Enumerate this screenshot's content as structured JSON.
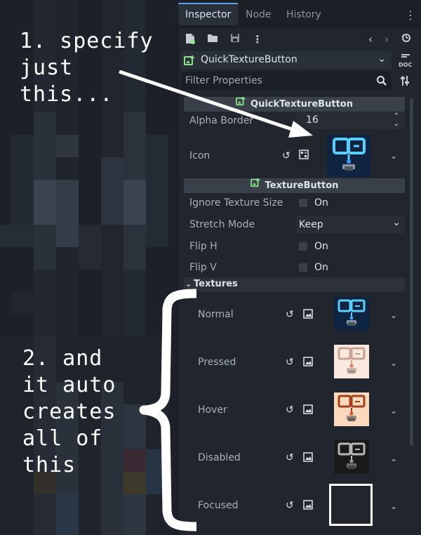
{
  "annotations": {
    "step1": "1. specify\njust\nthis...",
    "step2": "2. and\nit auto\ncreates\nall of\nthis"
  },
  "tabs": [
    {
      "label": "Inspector",
      "active": true
    },
    {
      "label": "Node",
      "active": false
    },
    {
      "label": "History",
      "active": false
    }
  ],
  "toolbar": {
    "icons": [
      "new-resource-icon",
      "open-folder-icon",
      "save-icon",
      "more-vertical-icon",
      "nav-back-icon",
      "nav-forward-icon",
      "history-icon"
    ],
    "doc_button": "DOC"
  },
  "selector": {
    "node_name": "QuickTextureButton"
  },
  "filter": {
    "placeholder": "Filter Properties"
  },
  "sections": {
    "quick_texture_button": {
      "title": "QuickTextureButton",
      "alpha_border": {
        "label": "Alpha Border",
        "value": "16"
      },
      "icon": {
        "label": "Icon"
      }
    },
    "texture_button": {
      "title": "TextureButton",
      "ignore_texture_size": {
        "label": "Ignore Texture Size",
        "value": "On"
      },
      "stretch_mode": {
        "label": "Stretch Mode",
        "value": "Keep"
      },
      "flip_h": {
        "label": "Flip H",
        "value": "On"
      },
      "flip_v": {
        "label": "Flip V",
        "value": "On"
      },
      "textures": {
        "title": "Textures",
        "items": [
          {
            "label": "Normal"
          },
          {
            "label": "Pressed"
          },
          {
            "label": "Hover"
          },
          {
            "label": "Disabled"
          },
          {
            "label": "Focused"
          }
        ]
      }
    }
  },
  "colors": {
    "accent": "#5f9ee8",
    "panel": "#21262e",
    "header": "#3a404a",
    "normal_tex": "#5bd0ff",
    "pressed_tex": "#f3dfd5",
    "hover_tex": "#f9d8bd",
    "disabled_tex": "#1d1d1d"
  }
}
